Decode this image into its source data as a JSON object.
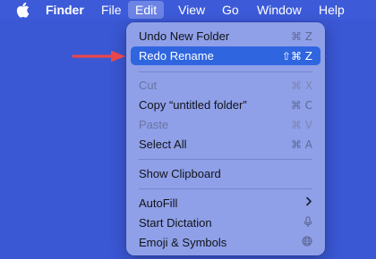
{
  "menubar": {
    "items": [
      {
        "label": "Finder"
      },
      {
        "label": "File"
      },
      {
        "label": "Edit"
      },
      {
        "label": "View"
      },
      {
        "label": "Go"
      },
      {
        "label": "Window"
      },
      {
        "label": "Help"
      }
    ]
  },
  "edit_menu": {
    "items": [
      {
        "label": "Undo New Folder",
        "shortcut": "⌘ Z",
        "enabled": true
      },
      {
        "label": "Redo Rename",
        "shortcut": "⇧⌘ Z",
        "enabled": true,
        "highlighted": true
      },
      {
        "label": "Cut",
        "shortcut": "⌘ X",
        "enabled": false
      },
      {
        "label": "Copy “untitled folder”",
        "shortcut": "⌘ C",
        "enabled": true
      },
      {
        "label": "Paste",
        "shortcut": "⌘ V",
        "enabled": false
      },
      {
        "label": "Select All",
        "shortcut": "⌘ A",
        "enabled": true
      },
      {
        "label": "Show Clipboard",
        "enabled": true
      },
      {
        "label": "AutoFill",
        "enabled": true,
        "submenu": true
      },
      {
        "label": "Start Dictation",
        "enabled": true,
        "icon": "microphone-icon"
      },
      {
        "label": "Emoji & Symbols",
        "enabled": true,
        "icon": "globe-icon"
      }
    ]
  },
  "colors": {
    "desktop": "#3a57d4",
    "menu_background": "#96a6e9",
    "highlight": "#2f65df",
    "annotation_arrow": "#e8474b"
  }
}
